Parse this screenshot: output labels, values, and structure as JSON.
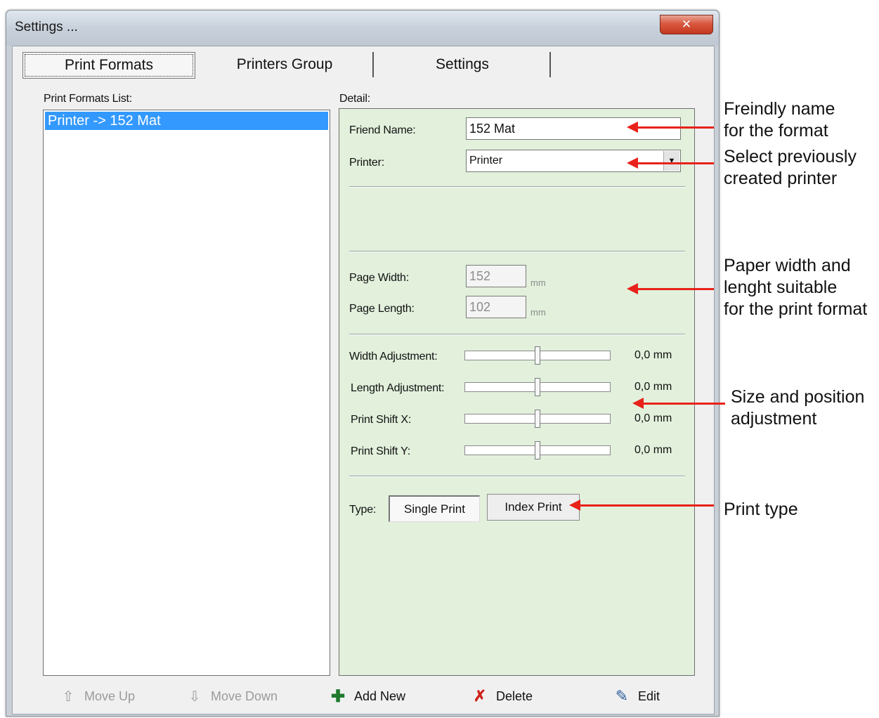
{
  "window": {
    "title": "Settings ...",
    "close_glyph": "✕"
  },
  "tabs": [
    {
      "label": "Print Formats",
      "active": true
    },
    {
      "label": "Printers Group",
      "active": false
    },
    {
      "label": "Settings",
      "active": false
    }
  ],
  "list": {
    "label": "Print Formats List:",
    "items": [
      {
        "label": "Printer -> 152 Mat",
        "selected": true
      }
    ]
  },
  "detail": {
    "label": "Detail:",
    "friend_name": {
      "label": "Friend Name:",
      "value": "152 Mat"
    },
    "printer": {
      "label": "Printer:",
      "value": "Printer"
    },
    "page_width": {
      "label": "Page Width:",
      "value": "152",
      "unit": "mm"
    },
    "page_length": {
      "label": "Page Length:",
      "value": "102",
      "unit": "mm"
    },
    "sliders": [
      {
        "label": "Width Adjustment:",
        "value": "0,0 mm",
        "position": 0.5
      },
      {
        "label": "Length Adjustment:",
        "value": "0,0 mm",
        "position": 0.5
      },
      {
        "label": "Print Shift X:",
        "value": "0,0 mm",
        "position": 0.5
      },
      {
        "label": "Print Shift Y:",
        "value": "0,0 mm",
        "position": 0.5
      }
    ],
    "type": {
      "label": "Type:",
      "single_print": "Single Print",
      "index_print": "Index Print",
      "selected": "Single Print"
    }
  },
  "toolbar": {
    "move_up": "Move Up",
    "move_down": "Move Down",
    "add_new": "Add New",
    "delete": "Delete",
    "edit": "Edit"
  },
  "annotations": {
    "friendly_name": "Freindly name\nfor the format",
    "select_printer": "Select previously\ncreated printer",
    "paper_size": "Paper width and\nlenght suitable\nfor the print format",
    "size_position": "Size and position\nadjustment",
    "print_type": "Print type"
  },
  "colors": {
    "selection": "#3399ff",
    "detail_bg": "#e2f0dc",
    "arrow": "#e8221a"
  },
  "icons": {
    "move_up": "arrow-up-icon",
    "move_down": "arrow-down-icon",
    "add_new": "plus-icon",
    "delete": "x-icon",
    "edit": "pencil-icon"
  }
}
